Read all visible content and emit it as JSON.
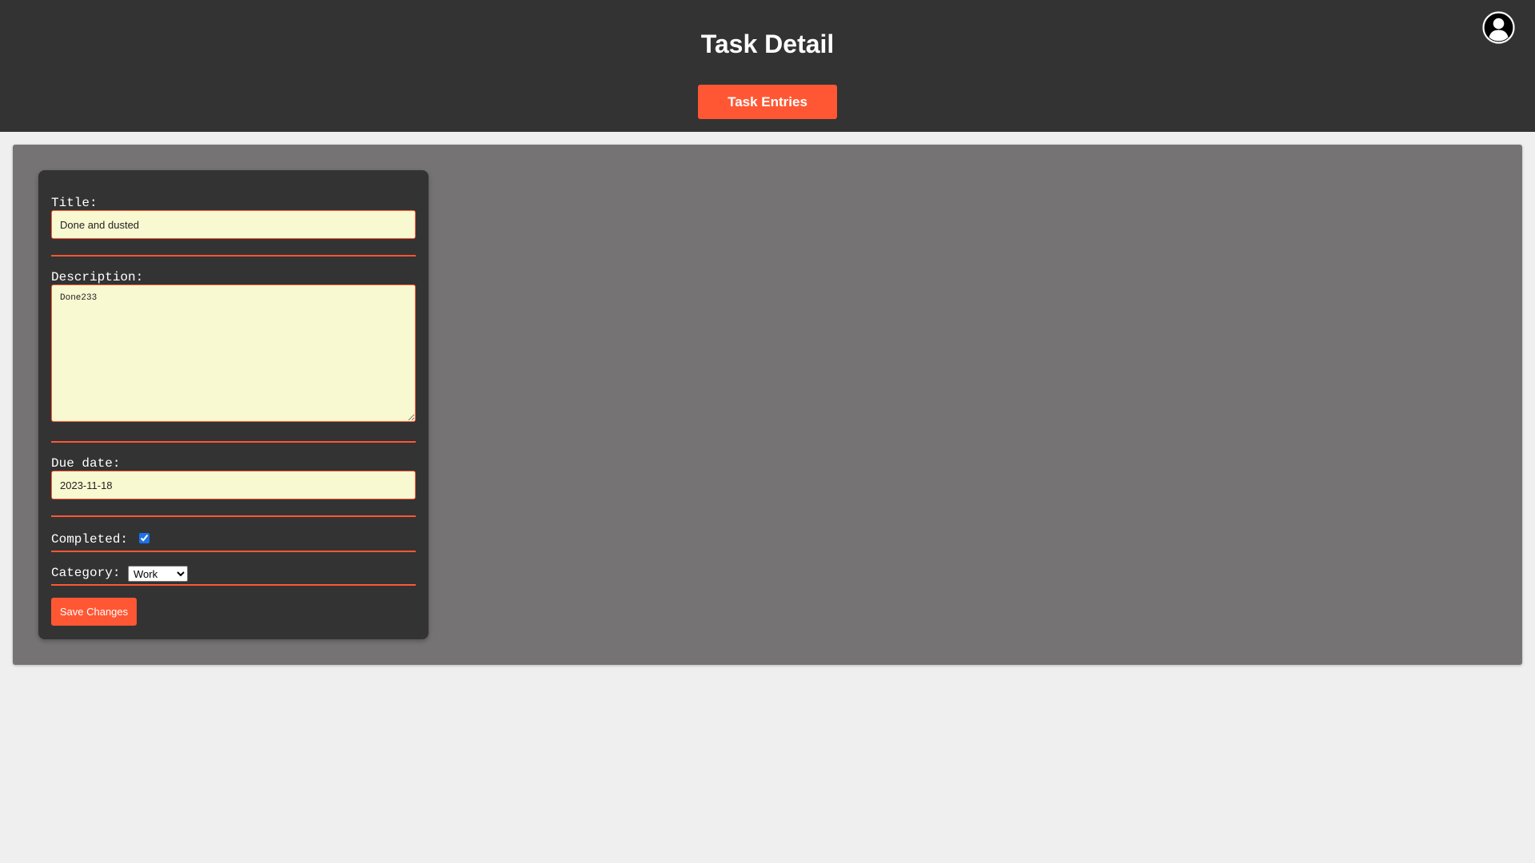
{
  "header": {
    "title": "Task Detail",
    "nav_button_label": "Task Entries",
    "avatar_icon": "user-circle-icon"
  },
  "form": {
    "title_label": "Title:",
    "title_value": "Done and dusted",
    "description_label": "Description:",
    "description_value": "Done233",
    "due_date_label": "Due date:",
    "due_date_value": "2023-11-18",
    "completed_label": "Completed:",
    "completed_checked": true,
    "category_label": "Category:",
    "category_value": "Work",
    "save_button_label": "Save Changes"
  },
  "colors": {
    "header_bg": "#333333",
    "accent": "#ff5733",
    "panel_bg": "#767374",
    "card_bg": "#333333",
    "field_bg": "#f8f8d1",
    "page_bg": "#efefef"
  }
}
